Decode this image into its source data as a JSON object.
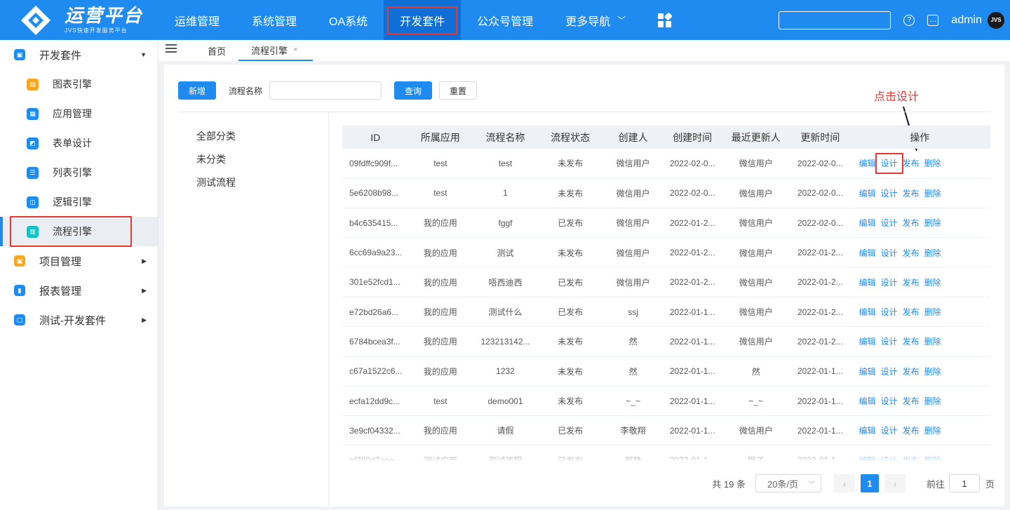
{
  "brand": {
    "title": "运营平台",
    "subtitle": "JVS快速开发服务平台"
  },
  "nav": [
    {
      "label": "运维管理"
    },
    {
      "label": "系统管理"
    },
    {
      "label": "OA系统"
    },
    {
      "label": "开发套件",
      "active": true
    },
    {
      "label": "公众号管理"
    },
    {
      "label": "更多导航"
    }
  ],
  "user": {
    "name": "admin",
    "avatar_text": "JVS"
  },
  "sidebar": {
    "group_main": "开发套件",
    "items": [
      {
        "label": "图表引擎",
        "color": "#f5a623",
        "icon": "document-icon"
      },
      {
        "label": "应用管理",
        "color": "#1f8bf1",
        "icon": "store-icon"
      },
      {
        "label": "表单设计",
        "color": "#1f8bf1",
        "icon": "form-icon"
      },
      {
        "label": "列表引擎",
        "color": "#1f8bf1",
        "icon": "list-icon"
      },
      {
        "label": "逻辑引擎",
        "color": "#1f8bf1",
        "icon": "logic-icon"
      },
      {
        "label": "流程引擎",
        "color": "#13c2c2",
        "icon": "flow-icon",
        "active": true
      }
    ],
    "groups": [
      {
        "label": "项目管理",
        "color": "#f5a623"
      },
      {
        "label": "报表管理",
        "color": "#1f8bf1"
      },
      {
        "label": "测试-开发套件",
        "color": "#1f8bf1"
      }
    ]
  },
  "tabs": {
    "home": "首页",
    "current": "流程引擎",
    "close": "×"
  },
  "toolbar": {
    "add": "新增",
    "name_label": "流程名称",
    "query": "查询",
    "reset": "重置"
  },
  "annotation": "点击设计",
  "categories": [
    "全部分类",
    "未分类",
    "测试流程"
  ],
  "table": {
    "columns": [
      "ID",
      "所属应用",
      "流程名称",
      "流程状态",
      "创建人",
      "创建时间",
      "最近更新人",
      "更新时间",
      "操作"
    ],
    "actions": [
      "编辑",
      "设计",
      "发布",
      "删除"
    ],
    "rows": [
      [
        "09fdffc909f...",
        "test",
        "test",
        "未发布",
        "微信用户",
        "2022-02-0...",
        "微信用户",
        "2022-02-0..."
      ],
      [
        "5e6208b98...",
        "test",
        "1",
        "未发布",
        "微信用户",
        "2022-02-0...",
        "微信用户",
        "2022-02-0..."
      ],
      [
        "b4c635415...",
        "我的应用",
        "fggf",
        "已发布",
        "微信用户",
        "2022-01-2...",
        "微信用户",
        "2022-02-0..."
      ],
      [
        "6cc69a9a23...",
        "我的应用",
        "测试",
        "未发布",
        "微信用户",
        "2022-01-2...",
        "微信用户",
        "2022-01-2..."
      ],
      [
        "301e52fcd1...",
        "我的应用",
        "唔西迪西",
        "已发布",
        "微信用户",
        "2022-01-2...",
        "微信用户",
        "2022-01-2..."
      ],
      [
        "e72bd26a6...",
        "我的应用",
        "测试什么",
        "已发布",
        "ssj",
        "2022-01-1...",
        "微信用户",
        "2022-01-2..."
      ],
      [
        "6784bcea3f...",
        "我的应用",
        "123213142...",
        "未发布",
        "然",
        "2022-01-1...",
        "微信用户",
        "2022-01-2..."
      ],
      [
        "c67a1522c6...",
        "我的应用",
        "1232",
        "未发布",
        "然",
        "2022-01-1...",
        "然",
        "2022-01-1..."
      ],
      [
        "ecfa12dd9c...",
        "test",
        "demo001",
        "未发布",
        "~_~",
        "2022-01-1...",
        "~_~",
        "2022-01-1..."
      ],
      [
        "3e9cf04332...",
        "我的应用",
        "请假",
        "已发布",
        "李敬翔",
        "2022-01-1...",
        "微信用户",
        "2022-01-1..."
      ],
      [
        "af790d7aee...",
        "测试应用",
        "测试流程",
        "已发布",
        "部静",
        "2022-01-1...",
        "猴子",
        "2022-01-1..."
      ]
    ]
  },
  "pagination": {
    "total": "共 19 条",
    "page_size": "20条/页",
    "current": "1",
    "goto_label": "前往",
    "goto_value": "1",
    "page_suffix": "页"
  }
}
